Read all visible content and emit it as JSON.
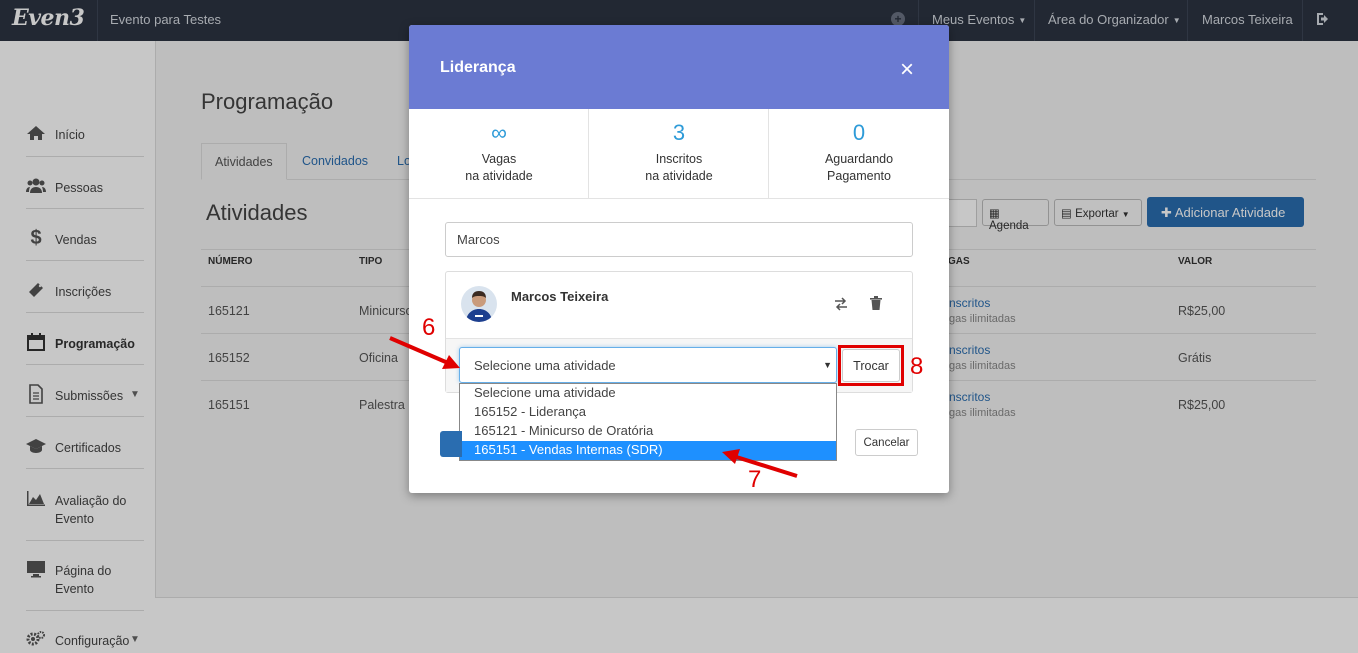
{
  "topbar": {
    "logo": "Even3",
    "event_name": "Evento para Testes",
    "menus": [
      "Meus Eventos",
      "Área do Organizador",
      "Marcos Teixeira"
    ]
  },
  "sidebar": {
    "items": [
      {
        "label": "Início",
        "icon": "home-icon"
      },
      {
        "label": "Pessoas",
        "icon": "users-icon"
      },
      {
        "label": "Vendas",
        "icon": "dollar-icon"
      },
      {
        "label": "Inscrições",
        "icon": "ticket-icon"
      },
      {
        "label": "Programação",
        "icon": "calendar-icon"
      },
      {
        "label": "Submissões",
        "icon": "document-icon"
      },
      {
        "label": "Certificados",
        "icon": "graduation-cap-icon"
      },
      {
        "label": "Avaliação do Evento",
        "icon": "area-chart-icon"
      },
      {
        "label": "Página do Evento",
        "icon": "monitor-icon"
      },
      {
        "label": "Configuração",
        "icon": "gears-icon"
      }
    ]
  },
  "page": {
    "title": "Programação",
    "tabs": [
      "Atividades",
      "Convidados",
      "Lo"
    ],
    "section_title": "Atividades",
    "buttons": {
      "agenda": "Agenda",
      "exportar": "Exportar",
      "adicionar": "Adicionar Atividade"
    },
    "table": {
      "headers": [
        "NÚMERO",
        "TIPO",
        "GAS",
        "VALOR"
      ],
      "rows": [
        {
          "numero": "165121",
          "tipo": "Minicurso",
          "inscritos": "nscritos",
          "vagas": "gas ilimitadas",
          "valor": "R$25,00"
        },
        {
          "numero": "165152",
          "tipo": "Oficina",
          "inscritos": "nscritos",
          "vagas": "gas ilimitadas",
          "valor": "Grátis"
        },
        {
          "numero": "165151",
          "tipo": "Palestra",
          "inscritos": "nscritos",
          "vagas": "gas ilimitadas",
          "valor": "R$25,00"
        }
      ]
    }
  },
  "modal": {
    "title": "Liderança",
    "close": "×",
    "stats": [
      {
        "value": "∞",
        "line1": "Vagas",
        "line2": "na atividade"
      },
      {
        "value": "3",
        "line1": "Inscritos",
        "line2": "na atividade"
      },
      {
        "value": "0",
        "line1": "Aguardando",
        "line2": "Pagamento"
      }
    ],
    "search_value": "Marcos",
    "person_name": "Marcos Teixeira",
    "select_value": "Selecione uma atividade",
    "options": [
      "Selecione uma atividade",
      "165152 - Liderança",
      "165121 - Minicurso de Oratória",
      "165151 - Vendas Internas (SDR)"
    ],
    "trocar_label": "Trocar",
    "cancel_label": "Cancelar"
  },
  "annotations": {
    "step6": "6",
    "step7": "7",
    "step8": "8",
    "color": "#e00000"
  },
  "colors": {
    "topbar": "#2c3442",
    "modal_header": "#6b7bd3",
    "primary": "#2a6db0",
    "stat_number": "#2e9bd8",
    "option_selected": "#1e90ff"
  }
}
